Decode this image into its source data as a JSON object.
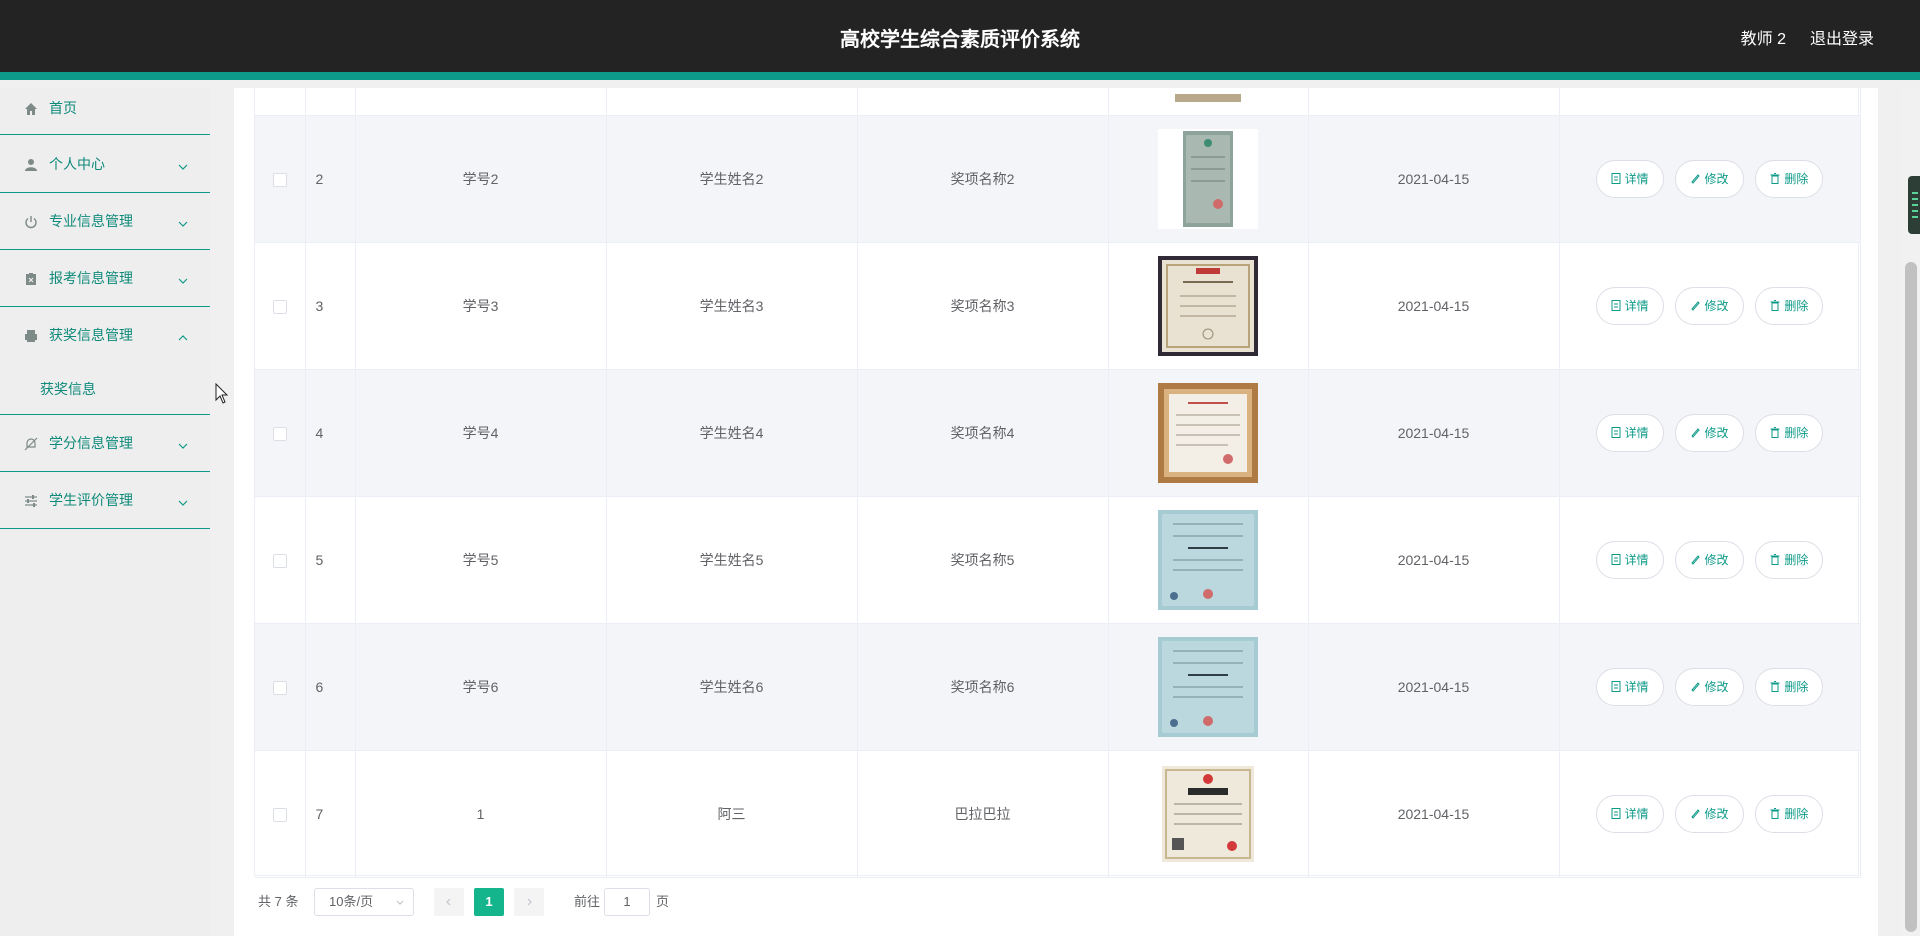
{
  "header": {
    "title": "高校学生综合素质评价系统",
    "user": "教师 2",
    "logout": "退出登录"
  },
  "sidebar": {
    "items": [
      {
        "label": "首页",
        "icon": "home-icon"
      },
      {
        "label": "个人中心",
        "icon": "user-icon"
      },
      {
        "label": "专业信息管理",
        "icon": "power-icon"
      },
      {
        "label": "报考信息管理",
        "icon": "clipboard-icon"
      },
      {
        "label": "获奖信息管理",
        "icon": "printer-icon"
      },
      {
        "label": "学分信息管理",
        "icon": "bell-off-icon"
      },
      {
        "label": "学生评价管理",
        "icon": "sliders-icon"
      }
    ],
    "submenu": {
      "label": "获奖信息"
    }
  },
  "table": {
    "rows": [
      {
        "index": "2",
        "student_id": "学号2",
        "student_name": "学生姓名2",
        "award_name": "奖项名称2",
        "date": "2021-04-15"
      },
      {
        "index": "3",
        "student_id": "学号3",
        "student_name": "学生姓名3",
        "award_name": "奖项名称3",
        "date": "2021-04-15"
      },
      {
        "index": "4",
        "student_id": "学号4",
        "student_name": "学生姓名4",
        "award_name": "奖项名称4",
        "date": "2021-04-15"
      },
      {
        "index": "5",
        "student_id": "学号5",
        "student_name": "学生姓名5",
        "award_name": "奖项名称5",
        "date": "2021-04-15"
      },
      {
        "index": "6",
        "student_id": "学号6",
        "student_name": "学生姓名6",
        "award_name": "奖项名称6",
        "date": "2021-04-15"
      },
      {
        "index": "7",
        "student_id": "1",
        "student_name": "阿三",
        "award_name": "巴拉巴拉",
        "date": "2021-04-15"
      }
    ],
    "actions": {
      "detail": "详情",
      "edit": "修改",
      "delete": "删除"
    }
  },
  "pagination": {
    "total": "共 7 条",
    "page_size": "10条/页",
    "current_page": "1",
    "goto_label": "前往",
    "goto_value": "1",
    "page_suffix": "页"
  },
  "colors": {
    "accent": "#0e9a88",
    "header_bg": "#232323",
    "pager_active": "#14b48c"
  }
}
